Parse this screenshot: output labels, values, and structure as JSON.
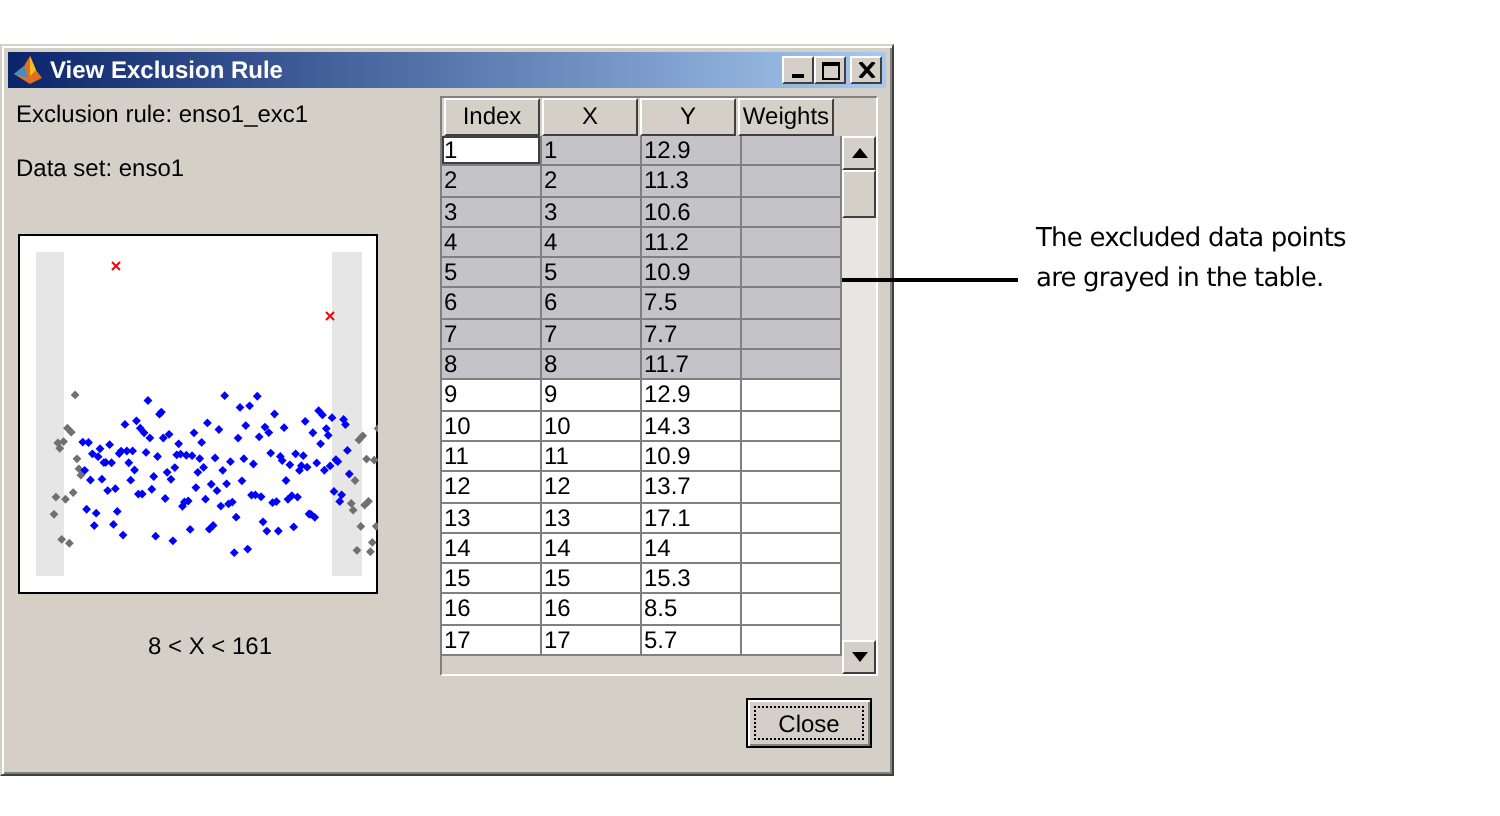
{
  "window": {
    "title": "View Exclusion Rule"
  },
  "exclusion_rule": "Exclusion rule: enso1_exc1",
  "data_set": "Data set: enso1",
  "plot_caption": "8 < X < 161",
  "table": {
    "columns": [
      "Index",
      "X",
      "Y",
      "Weights"
    ],
    "rows": [
      {
        "cells": [
          "1",
          "1",
          "12.9"
        ],
        "excluded": true,
        "current": true
      },
      {
        "cells": [
          "2",
          "2",
          "11.3"
        ],
        "excluded": true,
        "current": false
      },
      {
        "cells": [
          "3",
          "3",
          "10.6"
        ],
        "excluded": true,
        "current": false
      },
      {
        "cells": [
          "4",
          "4",
          "11.2"
        ],
        "excluded": true,
        "current": false
      },
      {
        "cells": [
          "5",
          "5",
          "10.9"
        ],
        "excluded": true,
        "current": false
      },
      {
        "cells": [
          "6",
          "6",
          "7.5"
        ],
        "excluded": true,
        "current": false
      },
      {
        "cells": [
          "7",
          "7",
          "7.7"
        ],
        "excluded": true,
        "current": false
      },
      {
        "cells": [
          "8",
          "8",
          "11.7"
        ],
        "excluded": true,
        "current": false
      },
      {
        "cells": [
          "9",
          "9",
          "12.9"
        ],
        "excluded": false,
        "current": false
      },
      {
        "cells": [
          "10",
          "10",
          "14.3"
        ],
        "excluded": false,
        "current": false
      },
      {
        "cells": [
          "11",
          "11",
          "10.9"
        ],
        "excluded": false,
        "current": false
      },
      {
        "cells": [
          "12",
          "12",
          "13.7"
        ],
        "excluded": false,
        "current": false
      },
      {
        "cells": [
          "13",
          "13",
          "17.1"
        ],
        "excluded": false,
        "current": false
      },
      {
        "cells": [
          "14",
          "14",
          "14"
        ],
        "excluded": false,
        "current": false
      },
      {
        "cells": [
          "15",
          "15",
          "15.3"
        ],
        "excluded": false,
        "current": false
      },
      {
        "cells": [
          "16",
          "16",
          "8.5"
        ],
        "excluded": false,
        "current": false
      },
      {
        "cells": [
          "17",
          "17",
          "5.7"
        ],
        "excluded": false,
        "current": false
      }
    ]
  },
  "buttons": [
    {
      "label": "Close",
      "focused": true
    }
  ],
  "annotation": [
    "The excluded data points",
    "are grayed in the table."
  ]
}
